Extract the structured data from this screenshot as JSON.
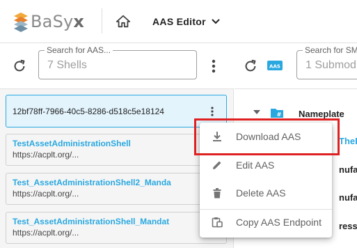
{
  "header": {
    "logo_text": "BaSy",
    "logo_x": "x",
    "editor_menu_label": "AAS Editor"
  },
  "left_panel": {
    "search": {
      "label": "Search for AAS...",
      "value": "7 Shells"
    },
    "shells": [
      {
        "id": "12bf78ff-7966-40c5-8286-d518c5e18124",
        "selected": true
      },
      {
        "title": "TestAssetAdministrationShell",
        "url": "https://acplt.org/..."
      },
      {
        "title": "Test_AssetAdministrationShell2_Manda",
        "url": "https://acplt.org/..."
      },
      {
        "title": "Test_AssetAdministrationShell_Mandat",
        "url": "https://acplt.org/..."
      }
    ]
  },
  "right_panel": {
    "badge_text": "AAS",
    "search": {
      "label": "Search for SM",
      "value": "1 Submod"
    },
    "tree": [
      {
        "label": "Nameplate"
      },
      {
        "label": "ThePr"
      },
      {
        "label": "nufactu"
      },
      {
        "label": "nufactu"
      },
      {
        "label": "ressIn"
      }
    ]
  },
  "context_menu": {
    "items": [
      {
        "label": "Download AAS",
        "icon": "download-icon",
        "highlighted": true
      },
      {
        "label": "Edit AAS",
        "icon": "pencil-icon"
      },
      {
        "label": "Delete AAS",
        "icon": "trash-icon"
      },
      {
        "label": "Copy AAS Endpoint",
        "icon": "clipboard-icon"
      }
    ]
  },
  "colors": {
    "accent": "#29a8e0",
    "highlight_border": "#e02020",
    "selected_card_bg": "#e3f4fd"
  }
}
